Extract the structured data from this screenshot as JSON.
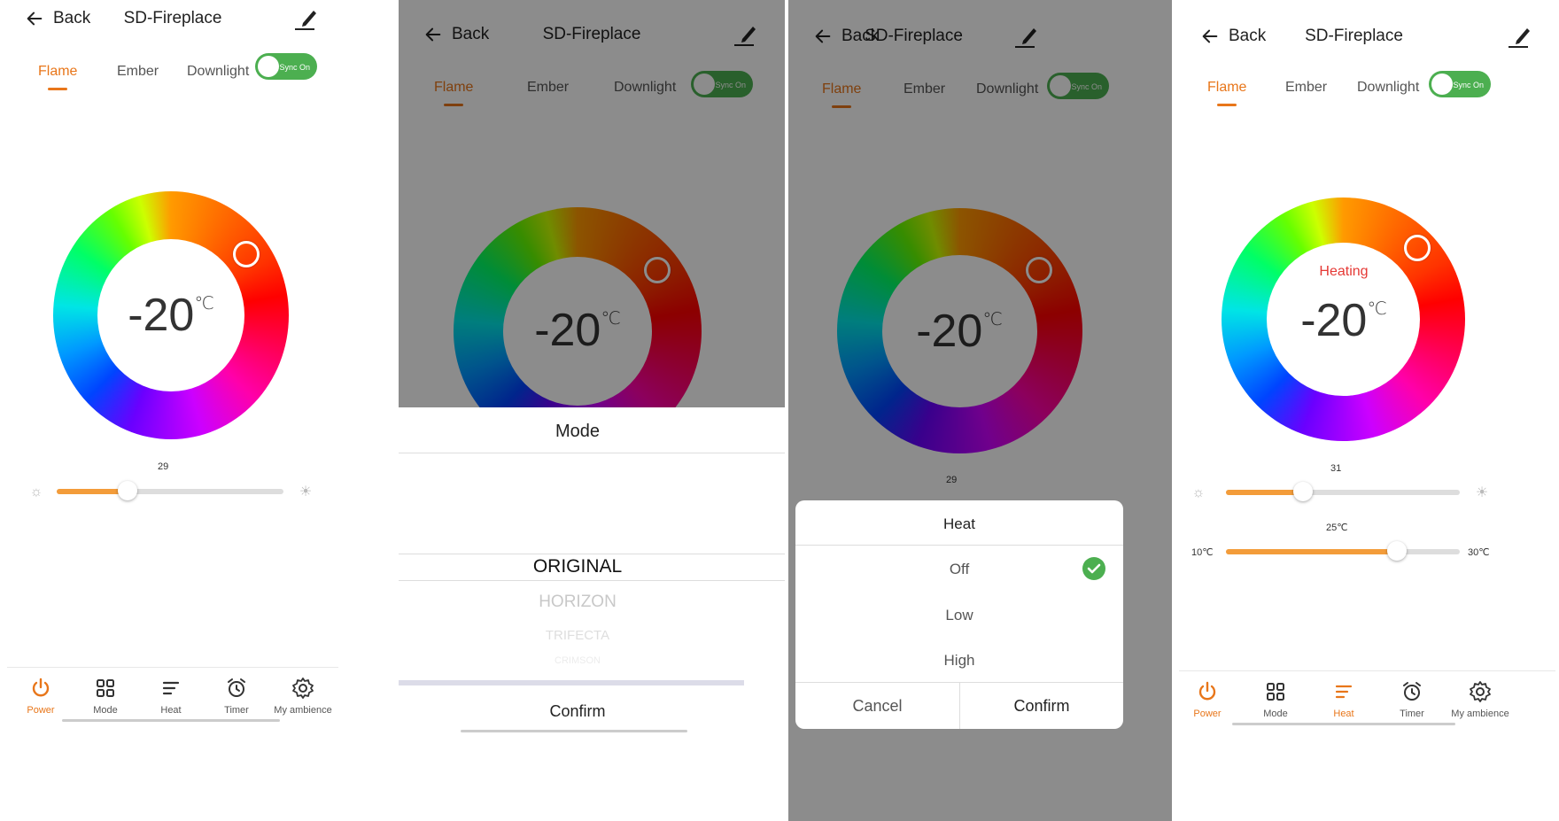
{
  "app": {
    "back_label": "Back",
    "title": "SD-Fireplace",
    "tabs": [
      "Flame",
      "Ember",
      "Downlight"
    ],
    "sync_label": "Sync On",
    "accent_color": "#e8761a",
    "toggle_color": "#4caf50"
  },
  "screens": [
    {
      "temperature": "-20",
      "unit": "℃",
      "brightness_value": "29",
      "brightness_fraction": 0.31
    },
    {
      "temperature": "-20",
      "unit": "℃",
      "mode_title": "Mode",
      "mode_options": [
        "ORIGINAL",
        "HORIZON",
        "TRIFECTA",
        "CRIMSON"
      ],
      "confirm_label": "Confirm"
    },
    {
      "temperature": "-20",
      "unit": "℃",
      "brightness_value": "29",
      "heat_title": "Heat",
      "heat_options": [
        "Off",
        "Low",
        "High"
      ],
      "cancel_label": "Cancel",
      "confirm_label": "Confirm"
    },
    {
      "status": "Heating",
      "temperature": "-20",
      "unit": "℃",
      "brightness_value": "31",
      "brightness_fraction": 0.33,
      "heat_target": "25℃",
      "heat_min": "10℃",
      "heat_max": "30℃",
      "heat_fraction": 0.73
    }
  ],
  "nav": {
    "items": [
      "Power",
      "Mode",
      "Heat",
      "Timer",
      "My ambience"
    ],
    "icons": [
      "power-icon",
      "grid-icon",
      "lines-icon",
      "alarm-clock-icon",
      "gear-icon"
    ]
  }
}
